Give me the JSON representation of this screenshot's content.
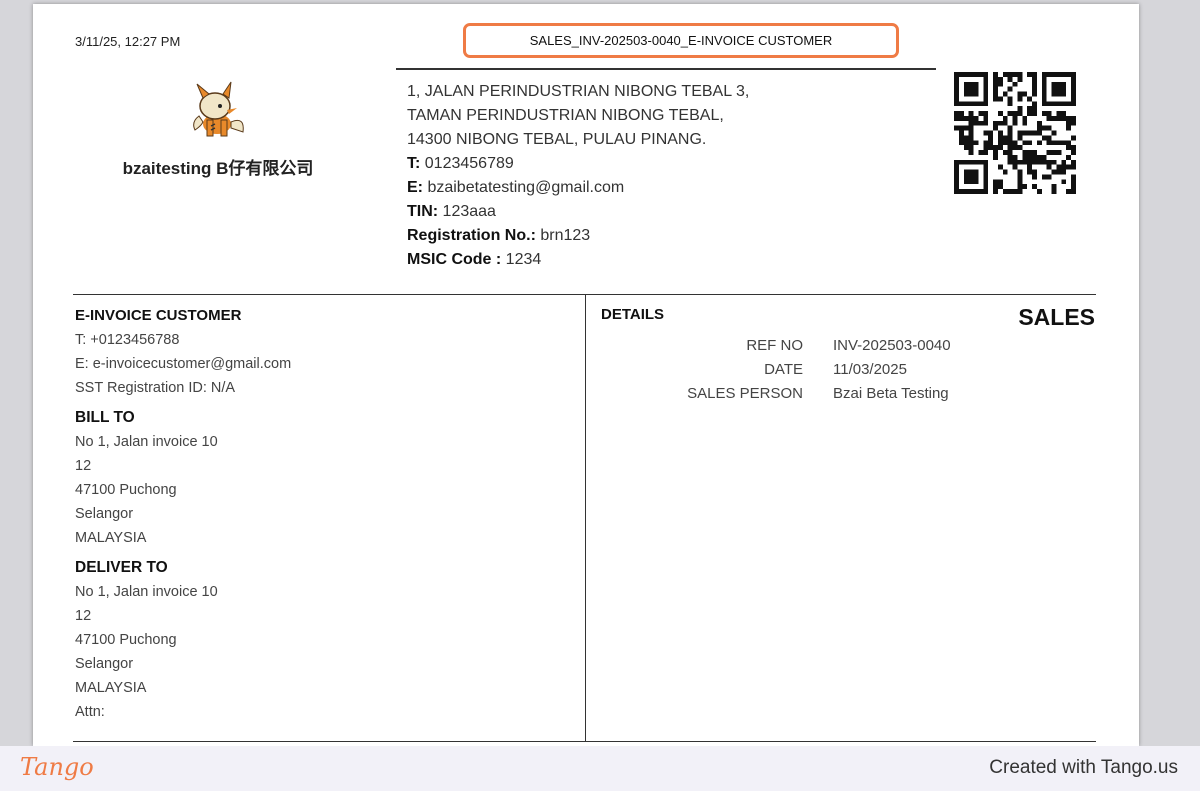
{
  "document": {
    "print_datetime": "3/11/25, 12:27 PM",
    "title": "SALES_INV-202503-0040_E-INVOICE CUSTOMER"
  },
  "company": {
    "name": "bzaitesting B仔有限公司",
    "address_lines": [
      "1, JALAN PERINDUSTRIAN NIBONG TEBAL 3,",
      "TAMAN PERINDUSTRIAN NIBONG TEBAL,",
      "14300 NIBONG TEBAL, PULAU PINANG."
    ],
    "fields": [
      {
        "label": "T:",
        "value": " 0123456789"
      },
      {
        "label": "E:",
        "value": " bzaibetatesting@gmail.com"
      },
      {
        "label": "TIN:",
        "value": " 123aaa"
      },
      {
        "label": "Registration No.:",
        "value": " brn123"
      },
      {
        "label": "MSIC Code :",
        "value": " 1234"
      }
    ]
  },
  "customer": {
    "name": "E-INVOICE CUSTOMER",
    "phone": "T: +0123456788",
    "email": "E: e-invoicecustomer@gmail.com",
    "sst": "SST Registration ID: N/A",
    "bill_to": {
      "heading": "BILL TO",
      "lines": [
        "No 1, Jalan invoice 10",
        "12",
        "47100 Puchong",
        "Selangor",
        "MALAYSIA"
      ]
    },
    "deliver_to": {
      "heading": "DELIVER TO",
      "lines": [
        "No 1, Jalan invoice 10",
        "12",
        "47100 Puchong",
        "Selangor",
        "MALAYSIA",
        "Attn:"
      ]
    }
  },
  "details": {
    "heading": "DETAILS",
    "doc_type": "SALES",
    "rows": [
      {
        "key": "REF NO",
        "value": "INV-202503-0040"
      },
      {
        "key": "DATE",
        "value": "11/03/2025"
      },
      {
        "key": "SALES PERSON",
        "value": "Bzai Beta Testing"
      }
    ]
  },
  "footer": {
    "logo_text": "Tango",
    "created_with": "Created with Tango.us"
  },
  "colors": {
    "highlight": "#ef7b45",
    "footer_bg": "#f2f1f8",
    "page_bg": "#d6d6da"
  },
  "icons": {
    "logo": "fox-mascot-icon",
    "qr": "qr-code-icon"
  }
}
